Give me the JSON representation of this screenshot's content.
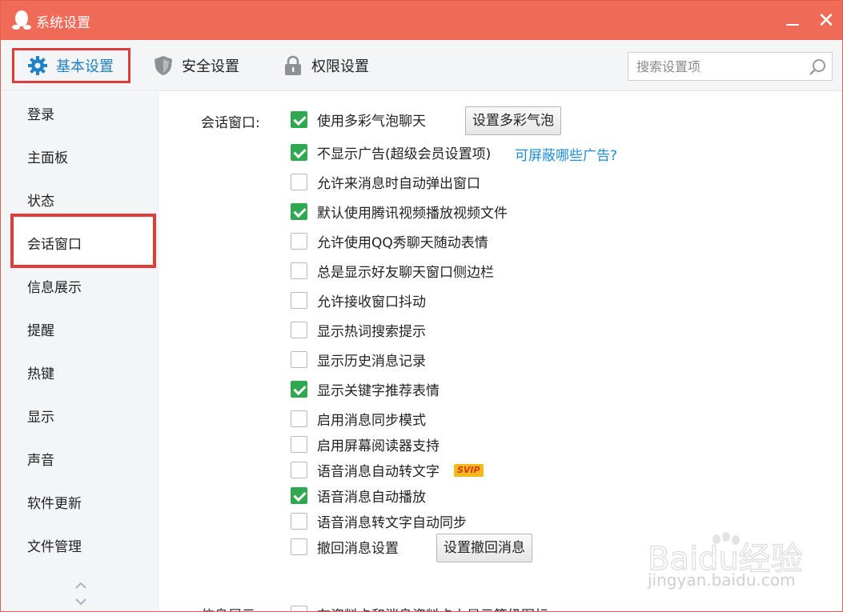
{
  "window": {
    "title": "系统设置"
  },
  "tabs": [
    {
      "label": "基本设置",
      "icon": "gear-icon",
      "active": true
    },
    {
      "label": "安全设置",
      "icon": "shield-icon"
    },
    {
      "label": "权限设置",
      "icon": "lock-icon"
    }
  ],
  "search": {
    "placeholder": "搜索设置项"
  },
  "sidebar": {
    "items": [
      {
        "label": "登录"
      },
      {
        "label": "主面板"
      },
      {
        "label": "状态"
      },
      {
        "label": "会话窗口",
        "active": true
      },
      {
        "label": "信息展示"
      },
      {
        "label": "提醒"
      },
      {
        "label": "热键"
      },
      {
        "label": "显示"
      },
      {
        "label": "声音"
      },
      {
        "label": "软件更新"
      },
      {
        "label": "文件管理"
      }
    ]
  },
  "main": {
    "section_label": "会话窗口:",
    "options": [
      {
        "label": "使用多彩气泡聊天",
        "checked": true
      },
      {
        "label": "不显示广告(超级会员设置项)",
        "checked": true
      },
      {
        "label": "允许来消息时自动弹出窗口",
        "checked": false
      },
      {
        "label": "默认使用腾讯视频播放视频文件",
        "checked": true
      },
      {
        "label": "允许使用QQ秀聊天随动表情",
        "checked": false
      },
      {
        "label": "总是显示好友聊天窗口侧边栏",
        "checked": false
      },
      {
        "label": "允许接收窗口抖动",
        "checked": false
      },
      {
        "label": "显示热词搜索提示",
        "checked": false
      },
      {
        "label": "显示历史消息记录",
        "checked": false
      },
      {
        "label": "显示关键字推荐表情",
        "checked": true
      },
      {
        "label": "启用消息同步模式",
        "checked": false
      },
      {
        "label": "启用屏幕阅读器支持",
        "checked": false
      },
      {
        "label": "语音消息自动转文字",
        "checked": false
      },
      {
        "label": "语音消息自动播放",
        "checked": true
      },
      {
        "label": "语音消息转文字自动同步",
        "checked": false
      },
      {
        "label": "撤回消息设置",
        "checked": false
      }
    ],
    "bubble_button": "设置多彩气泡",
    "ads_link": "可屏蔽哪些广告?",
    "svip_badge": "SVIP",
    "recall_button": "设置撤回消息",
    "section2_label": "信息展示",
    "section2_option": "在资料卡和消息资料卡上显示等级图标"
  },
  "watermark": {
    "brand": "Baidu经验",
    "url": "jingyan.baidu.com"
  },
  "colors": {
    "titlebar": "#ef6b58",
    "accent": "#1f82c7",
    "highlight": "#e03c3c",
    "check": "#2fa84f",
    "link": "#1f8dd6"
  }
}
